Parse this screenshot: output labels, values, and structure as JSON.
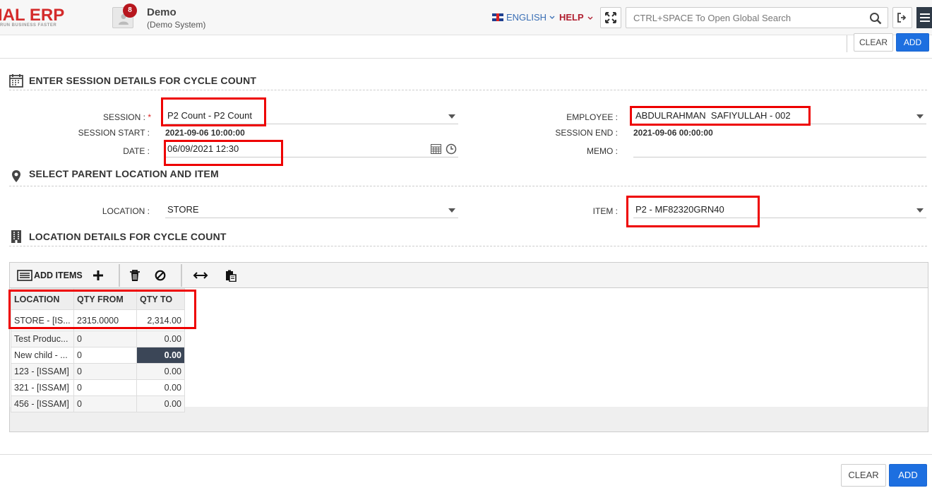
{
  "header": {
    "logo_text": "IAL ERP",
    "logo_tagline": "RUN BUSINESS FASTER",
    "notification_count": "8",
    "company_name": "Demo",
    "company_sub": "(Demo System)",
    "language": "ENGLISH",
    "help": "HELP",
    "search_placeholder": "CTRL+SPACE To Open Global Search"
  },
  "actions": {
    "clear_label": "CLEAR",
    "add_label": "ADD"
  },
  "sections": {
    "session": "ENTER SESSION DETAILS FOR CYCLE COUNT",
    "location": "SELECT PARENT LOCATION AND ITEM",
    "details": "LOCATION DETAILS FOR CYCLE COUNT"
  },
  "form": {
    "session_label": "SESSION :",
    "session_required": "*",
    "session_value": "P2 Count - P2 Count",
    "session_start_label": "SESSION START :",
    "session_start_value": "2021-09-06 10:00:00",
    "date_label": "DATE :",
    "date_value": "06/09/2021 12:30",
    "employee_label": "EMPLOYEE :",
    "employee_value": "ABDULRAHMAN  SAFIYULLAH - 002",
    "session_end_label": "SESSION END :",
    "session_end_value": "2021-09-06 00:00:00",
    "memo_label": "MEMO :",
    "memo_value": "",
    "location_label": "LOCATION :",
    "location_value": "STORE",
    "item_label": "ITEM :",
    "item_value": "P2 - MF82320GRN40"
  },
  "grid": {
    "add_items_label": "ADD ITEMS",
    "columns": [
      "LOCATION",
      "QTY FROM",
      "QTY TO"
    ],
    "rows": [
      {
        "location": "STORE - [IS...",
        "qty_from": "2315.0000",
        "qty_to": "2,314.00"
      },
      {
        "location": "Test Produc...",
        "qty_from": "0",
        "qty_to": "0.00"
      },
      {
        "location": "New child - ...",
        "qty_from": "0",
        "qty_to": "0.00"
      },
      {
        "location": "123 - [ISSAM]",
        "qty_from": "0",
        "qty_to": "0.00"
      },
      {
        "location": "321 - [ISSAM]",
        "qty_from": "0",
        "qty_to": "0.00"
      },
      {
        "location": "456 - [ISSAM]",
        "qty_from": "0",
        "qty_to": "0.00"
      }
    ]
  },
  "icons": [
    "flag-uk-icon",
    "expand-icon",
    "search-icon",
    "logout-icon",
    "menu-icon",
    "calendar-icon",
    "map-pin-icon",
    "building-icon",
    "list-icon",
    "plus-icon",
    "trash-icon",
    "cancel-icon",
    "resize-icon",
    "paste-icon",
    "clock-icon",
    "chevron-down-icon"
  ],
  "colors": {
    "brand_red": "#d42b2b",
    "primary_blue": "#1d6fe0",
    "highlight_red": "#e00000",
    "selected_cell": "#3b4657"
  }
}
